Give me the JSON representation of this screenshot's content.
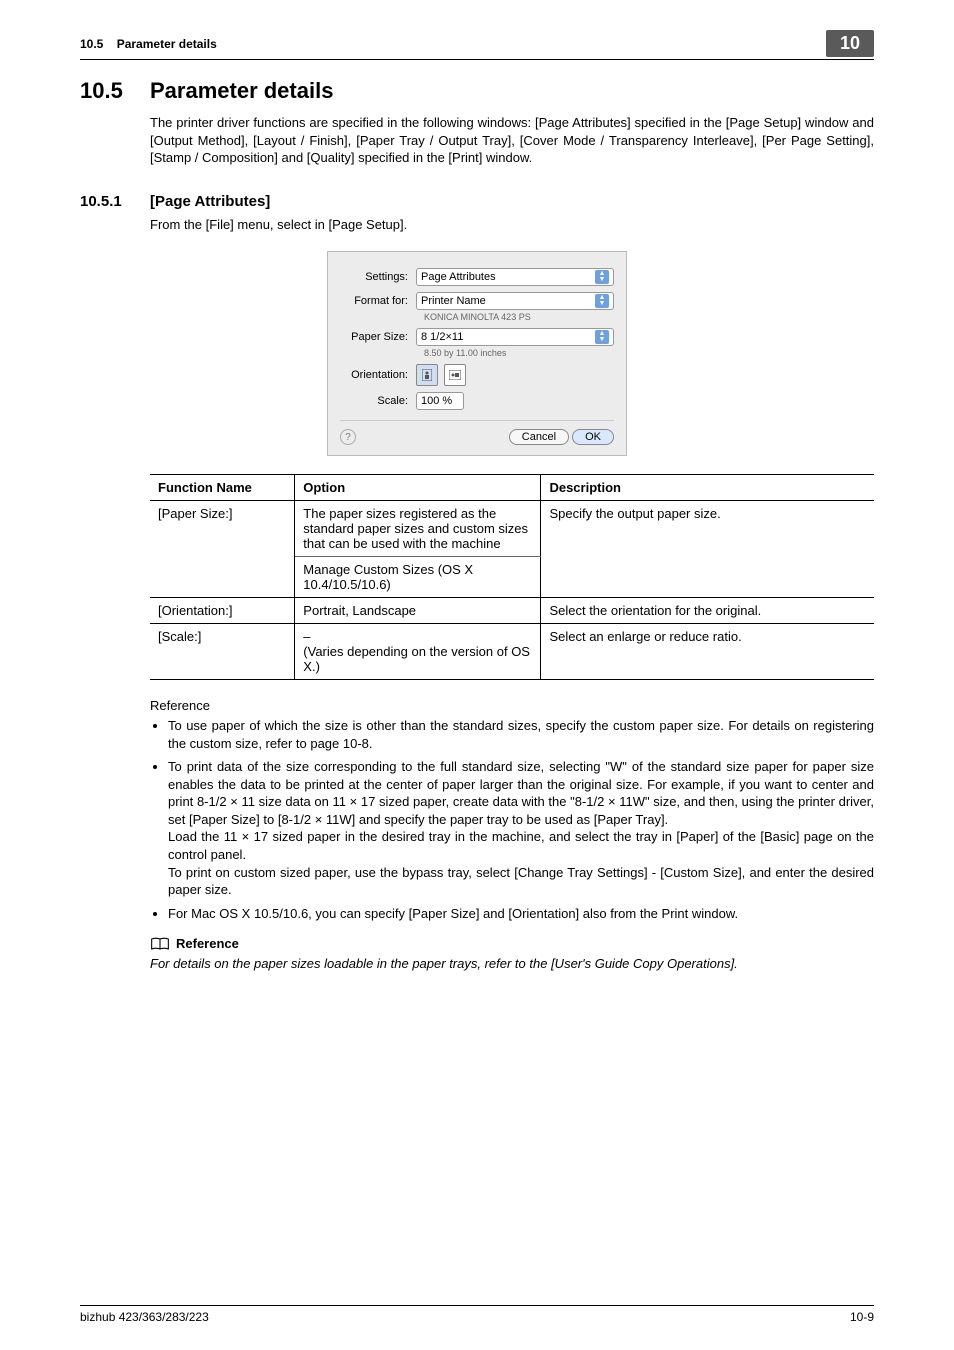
{
  "header": {
    "section_number": "10.5",
    "section_title": "Parameter details",
    "chapter_badge": "10"
  },
  "h1_title": "Parameter details",
  "intro_paragraph": "The printer driver functions are specified in the following windows: [Page Attributes] specified in the [Page Setup] window and [Output Method], [Layout / Finish], [Paper Tray / Output Tray], [Cover Mode / Transparency Interleave], [Per Page Setting], [Stamp / Composition] and [Quality] specified in the [Print] window.",
  "h2_number": "10.5.1",
  "h2_title": "[Page Attributes]",
  "h2_caption": "From the [File] menu, select in [Page Setup].",
  "dialog": {
    "labels": {
      "settings": "Settings:",
      "format_for": "Format for:",
      "paper_size": "Paper Size:",
      "orientation": "Orientation:",
      "scale": "Scale:"
    },
    "settings_value": "Page Attributes",
    "format_value": "Printer Name",
    "format_sub": "KONICA MINOLTA 423 PS",
    "paper_value": "8 1/2×11",
    "paper_sub": "8.50 by 11.00 inches",
    "scale_value": "100 %",
    "btn_cancel": "Cancel",
    "btn_ok": "OK",
    "help_glyph": "?"
  },
  "table": {
    "head": {
      "fn": "Function Name",
      "opt": "Option",
      "desc": "Description"
    },
    "rows": {
      "paper": {
        "fn": "[Paper Size:]",
        "opt1": "The paper sizes registered as the standard paper sizes and custom sizes that can be used with the machine",
        "opt2": "Manage Custom Sizes (OS X 10.4/10.5/10.6)",
        "desc": "Specify the output paper size."
      },
      "orient": {
        "fn": "[Orientation:]",
        "opt": "Portrait, Landscape",
        "desc": "Select the orientation for the original."
      },
      "scale": {
        "fn": "[Scale:]",
        "opt": "–\n(Varies depending on the version of OS X.)",
        "desc": "Select an enlarge or reduce ratio."
      }
    }
  },
  "reference_label": "Reference",
  "bullets": [
    "To use paper of which the size is other than the standard sizes, specify the custom paper size. For details on registering the custom size, refer to page 10-8.",
    "To print data of the size corresponding to the full standard size, selecting \"W\" of the standard size paper for paper size enables the data to be printed at the center of paper larger than the original size. For example, if you want to center and print 8-1/2 × 11 size data on 11 × 17 sized paper, create data with the \"8-1/2 × 11W\" size, and then, using the printer driver, set [Paper Size] to [8-1/2 × 11W] and specify the paper tray to be used as [Paper Tray].\nLoad the 11 × 17 sized paper in the desired tray in the machine, and select the tray in [Paper] of the [Basic] page on the control panel.\nTo print on custom sized paper, use the bypass tray, select [Change Tray Settings] - [Custom Size], and enter the desired paper size.",
    "For Mac OS X 10.5/10.6, you can specify [Paper Size] and [Orientation] also from the Print window."
  ],
  "reference_block": {
    "title": "Reference",
    "text": "For details on the paper sizes loadable in the paper trays, refer to the [User's Guide Copy Operations]."
  },
  "footer": {
    "left": "bizhub 423/363/283/223",
    "right": "10-9"
  }
}
